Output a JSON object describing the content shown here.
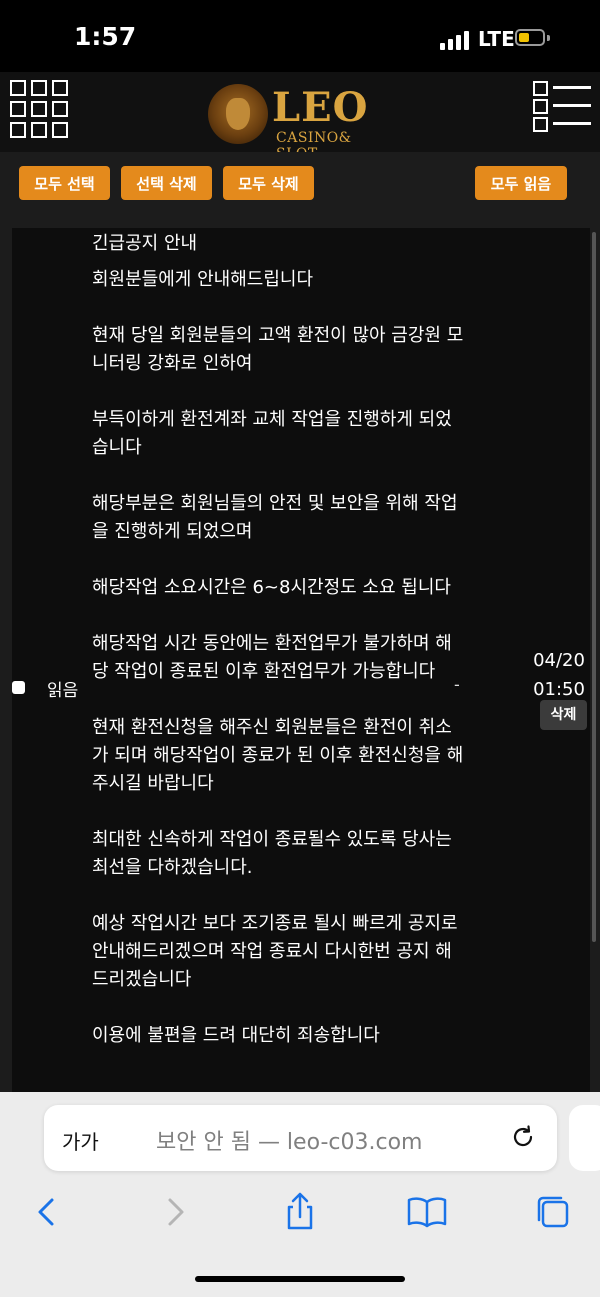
{
  "status_bar": {
    "time": "1:57",
    "network": "LTE"
  },
  "header": {
    "logo_word": "LEO",
    "logo_subtitle": "CASINO& SLOT"
  },
  "toolbar": {
    "select_all": "모두 선택",
    "delete_selected": "선택 삭제",
    "delete_all": "모두 삭제",
    "read_all": "모두 읽음"
  },
  "message": {
    "status": "읽음",
    "separator": "-",
    "date": "04/20",
    "time": "01:50",
    "delete_label": "삭제",
    "title": "긴급공지 안내",
    "paragraphs": [
      "회원분들에게 안내해드립니다",
      "현재 당일 회원분들의 고액 환전이 많아 금강원 모니터링 강화로 인하여",
      "부득이하게 환전계좌 교체 작업을 진행하게 되었습니다",
      "해당부분은 회원님들의 안전 및 보안을 위해 작업을 진행하게 되었으며",
      "해당작업 소요시간은 6~8시간정도 소요 됩니다",
      "해당작업 시간 동안에는 환전업무가 불가하며 해당 작업이 종료된 이후 환전업무가 가능합니다",
      "현재 환전신청을 해주신 회원분들은 환전이 취소가 되며 해당작업이 종료가 된 이후 환전신청을 해주시길 바랍니다",
      "최대한 신속하게 작업이 종료될수 있도록 당사는 최선을 다하겠습니다.",
      "예상 작업시간 보다 조기종료 될시 빠르게 공지로 안내해드리겠으며 작업 종료시 다시한번 공지 해드리겠습니다",
      "이용에 불편을 드려 대단히 죄송합니다"
    ]
  },
  "browser": {
    "text_size_label": "가가",
    "security_label": "보안 안 됨 — leo-c03.com"
  },
  "colors": {
    "accent": "#e48a1c",
    "link_blue": "#1a73e8"
  }
}
